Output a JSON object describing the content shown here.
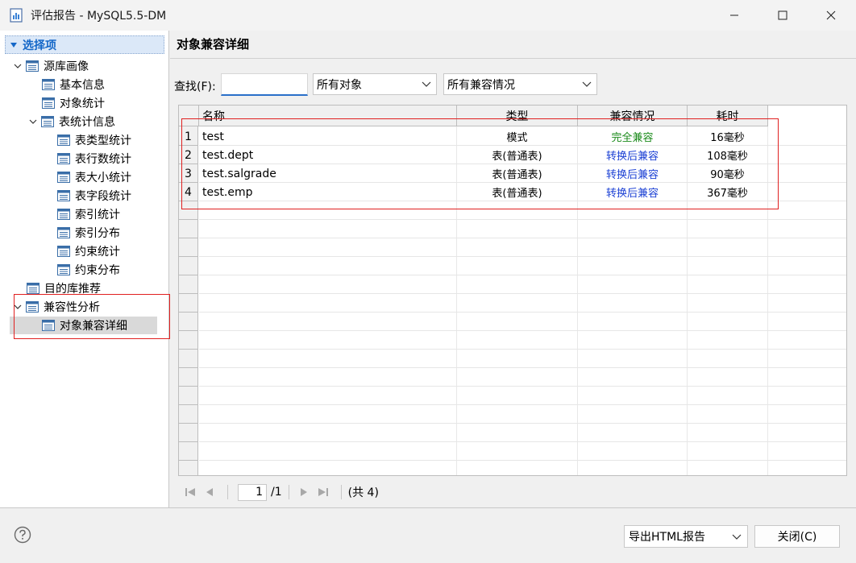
{
  "window": {
    "title": "评估报告 - MySQL5.5-DM"
  },
  "tree": {
    "header": "选择项",
    "items": [
      {
        "label": "源库画像"
      },
      {
        "label": "基本信息"
      },
      {
        "label": "对象统计"
      },
      {
        "label": "表统计信息"
      },
      {
        "label": "表类型统计"
      },
      {
        "label": "表行数统计"
      },
      {
        "label": "表大小统计"
      },
      {
        "label": "表字段统计"
      },
      {
        "label": "索引统计"
      },
      {
        "label": "索引分布"
      },
      {
        "label": "约束统计"
      },
      {
        "label": "约束分布"
      },
      {
        "label": "目的库推荐"
      },
      {
        "label": "兼容性分析"
      },
      {
        "label": "对象兼容详细"
      }
    ]
  },
  "main": {
    "title": "对象兼容详细",
    "search_label": "查找(F):",
    "search_value": "",
    "object_filter": "所有对象",
    "compat_filter": "所有兼容情况",
    "columns": [
      "名称",
      "类型",
      "兼容情况",
      "耗时"
    ],
    "rows": [
      {
        "num": "1",
        "name": "test",
        "type": "模式",
        "compat": "完全兼容",
        "time": "16毫秒"
      },
      {
        "num": "2",
        "name": "test.dept",
        "type": "表(普通表)",
        "compat": "转换后兼容",
        "time": "108毫秒"
      },
      {
        "num": "3",
        "name": "test.salgrade",
        "type": "表(普通表)",
        "compat": "转换后兼容",
        "time": "90毫秒"
      },
      {
        "num": "4",
        "name": "test.emp",
        "type": "表(普通表)",
        "compat": "转换后兼容",
        "time": "367毫秒"
      }
    ],
    "colors": {
      "full_compat": "#1a8a1a",
      "converted_compat": "#1a3fd4",
      "highlight_box": "#e02020"
    }
  },
  "pager": {
    "page": "1",
    "total_pages": "/1",
    "total": "(共 4)"
  },
  "footer": {
    "export_label": "导出HTML报告",
    "close_label": "关闭(C)"
  }
}
